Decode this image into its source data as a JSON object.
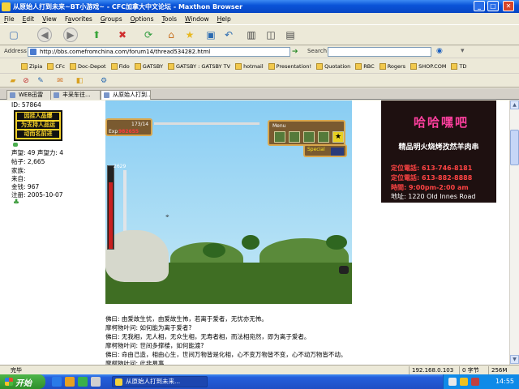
{
  "window": {
    "title": "从原始人打到未来~BT小游戏~ - CFC加拿大中文论坛 - Maxthon Browser",
    "minimize": "_",
    "maximize": "□",
    "close": "✕"
  },
  "menu": [
    {
      "key": "F",
      "rest": "ile"
    },
    {
      "key": "E",
      "rest": "dit"
    },
    {
      "key": "V",
      "rest": "iew"
    },
    {
      "key": "a",
      "pre": "F",
      "rest": "vorites"
    },
    {
      "key": "G",
      "rest": "roups"
    },
    {
      "key": "O",
      "rest": "ptions"
    },
    {
      "key": "T",
      "rest": "ools"
    },
    {
      "key": "W",
      "rest": "indow"
    },
    {
      "key": "H",
      "rest": "elp"
    }
  ],
  "address": {
    "label": "Address",
    "url": "http://bbs.comefromchina.com/forum14/thread534282.html",
    "search_label": "Search"
  },
  "links": [
    "Zipia",
    "CFc",
    "Doc-Depot",
    "Fido",
    "GATSBY",
    "GATSBY : GATSBY TV",
    "hotmail",
    "Presentation!",
    "Quotation",
    "RBC",
    "Rogers",
    "SHOP.COM",
    "TD"
  ],
  "tabs": [
    {
      "label": "WEB迅雷",
      "active": false
    },
    {
      "label": "丰采车往...",
      "active": false
    },
    {
      "label": "从原始人打到...",
      "active": true
    }
  ],
  "user": {
    "id": "ID: 57864",
    "badge_lines": [
      "因挂人品爆",
      "为支持人品运",
      "动而名前进"
    ],
    "reputation": "声望: 49 声望力: 4",
    "posts_label": "帖子: ",
    "posts": "2,665",
    "family": "家族:",
    "from": "来自:",
    "gold_label": "金钱: ",
    "gold": "967",
    "registered_label": "注册: ",
    "registered": "2005-10-07"
  },
  "game": {
    "hp": "173/14",
    "exp_label": "Exp",
    "exp": "982655",
    "menu_label": "Menu",
    "special_label": "Special",
    "hp_value": "2629"
  },
  "ad": {
    "title": "哈哈嘿吧",
    "headline": "精品明火烧烤孜然羊肉串",
    "phone1": "定位電話: 613-746-8181",
    "phone2": "定位電話: 613-882-8888",
    "hours": "時間: 9:00pm-2:00 am",
    "address": "地址: 1220 Old Innes Road"
  },
  "post_lines": [
    "佛曰: 由爱故生忧，由爱故生怖，若离于爱者，无忧亦无怖。",
    "摩柯物叶问: 如何能为离于爱者?",
    "佛曰: 无我相，无人相，无众生相，无寿者相，而法相宛然，即为离于爱者。",
    "摩柯物叶问: 世间多撑楼，如何能渡?",
    "佛曰: 命由己造，相由心生，世间万物皆是化相，心不变万物皆不变，心不动万物皆不动。",
    "摩柯物叶问: 此非易事"
  ],
  "status": {
    "text": "完毕",
    "ip": "192.168.0.103",
    "bytes": "0 字节",
    "memory": "256M"
  },
  "taskbar": {
    "start": "开始",
    "window": "从原始人打到未来...",
    "time": "14:55"
  }
}
